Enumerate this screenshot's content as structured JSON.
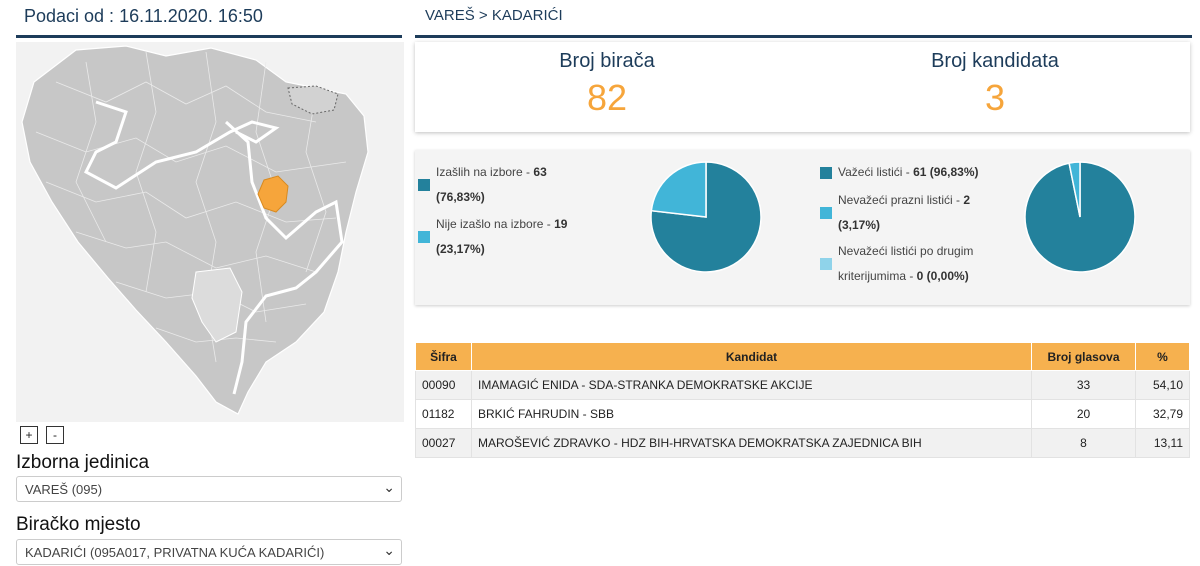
{
  "header": {
    "date_label": "Podaci od : 16.11.2020. 16:50"
  },
  "breadcrumb": "VAREŠ > KADARIĆI",
  "map": {
    "zoom_in": "+",
    "zoom_out": "-",
    "highlight_color": "#f6a53b"
  },
  "selectors": {
    "unit_label": "Izborna jedinica",
    "unit_value": "VAREŠ (095)",
    "station_label": "Biračko mjesto",
    "station_value": "KADARIĆI (095A017, PRIVATNA KUĆA KADARIĆI)"
  },
  "stats": {
    "voters_label": "Broj birača",
    "voters_value": "82",
    "candidates_label": "Broj kandidata",
    "candidates_value": "3"
  },
  "turnout": {
    "items": [
      {
        "label": "Izašlih na izbore - ",
        "count": "63",
        "pct": "(76,83%)",
        "color": "#23819c",
        "value": 76.83
      },
      {
        "label": "Nije izašlo na izbore - ",
        "count": "19",
        "pct": "(23,17%)",
        "color": "#41b5d8",
        "value": 23.17
      }
    ]
  },
  "ballots": {
    "items": [
      {
        "label": "Važeći listići - ",
        "count": "61 (96,83%)",
        "color": "#23819c",
        "value": 96.83
      },
      {
        "label": "Nevažeći prazni listići - ",
        "count": "2",
        "pct": "(3,17%)",
        "color": "#41b5d8",
        "value": 3.17
      },
      {
        "label": "Nevažeći listići po drugim kriterijumima - ",
        "count": "0 (0,00%)",
        "color": "#8fd3ea",
        "value": 0
      }
    ]
  },
  "table": {
    "headers": [
      "Šifra",
      "Kandidat",
      "Broj glasova",
      "%"
    ],
    "rows": [
      {
        "code": "00090",
        "name": "IMAMAGIĆ ENIDA - SDA-STRANKA DEMOKRATSKE AKCIJE",
        "votes": "33",
        "pct": "54,10"
      },
      {
        "code": "01182",
        "name": "BRKIĆ FAHRUDIN - SBB",
        "votes": "20",
        "pct": "32,79"
      },
      {
        "code": "00027",
        "name": "MAROŠEVIĆ ZDRAVKO - HDZ BIH-HRVATSKA DEMOKRATSKA ZAJEDNICA BIH",
        "votes": "8",
        "pct": "13,11"
      }
    ]
  }
}
